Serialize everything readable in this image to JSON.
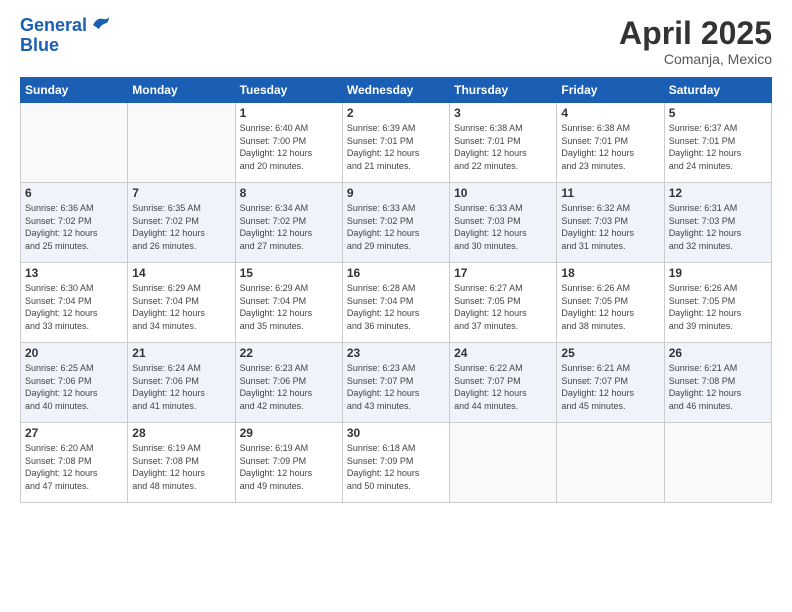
{
  "logo": {
    "line1": "General",
    "line2": "Blue"
  },
  "title": "April 2025",
  "location": "Comanja, Mexico",
  "weekdays": [
    "Sunday",
    "Monday",
    "Tuesday",
    "Wednesday",
    "Thursday",
    "Friday",
    "Saturday"
  ],
  "rows": [
    [
      {
        "day": "",
        "info": ""
      },
      {
        "day": "",
        "info": ""
      },
      {
        "day": "1",
        "info": "Sunrise: 6:40 AM\nSunset: 7:00 PM\nDaylight: 12 hours\nand 20 minutes."
      },
      {
        "day": "2",
        "info": "Sunrise: 6:39 AM\nSunset: 7:01 PM\nDaylight: 12 hours\nand 21 minutes."
      },
      {
        "day": "3",
        "info": "Sunrise: 6:38 AM\nSunset: 7:01 PM\nDaylight: 12 hours\nand 22 minutes."
      },
      {
        "day": "4",
        "info": "Sunrise: 6:38 AM\nSunset: 7:01 PM\nDaylight: 12 hours\nand 23 minutes."
      },
      {
        "day": "5",
        "info": "Sunrise: 6:37 AM\nSunset: 7:01 PM\nDaylight: 12 hours\nand 24 minutes."
      }
    ],
    [
      {
        "day": "6",
        "info": "Sunrise: 6:36 AM\nSunset: 7:02 PM\nDaylight: 12 hours\nand 25 minutes."
      },
      {
        "day": "7",
        "info": "Sunrise: 6:35 AM\nSunset: 7:02 PM\nDaylight: 12 hours\nand 26 minutes."
      },
      {
        "day": "8",
        "info": "Sunrise: 6:34 AM\nSunset: 7:02 PM\nDaylight: 12 hours\nand 27 minutes."
      },
      {
        "day": "9",
        "info": "Sunrise: 6:33 AM\nSunset: 7:02 PM\nDaylight: 12 hours\nand 29 minutes."
      },
      {
        "day": "10",
        "info": "Sunrise: 6:33 AM\nSunset: 7:03 PM\nDaylight: 12 hours\nand 30 minutes."
      },
      {
        "day": "11",
        "info": "Sunrise: 6:32 AM\nSunset: 7:03 PM\nDaylight: 12 hours\nand 31 minutes."
      },
      {
        "day": "12",
        "info": "Sunrise: 6:31 AM\nSunset: 7:03 PM\nDaylight: 12 hours\nand 32 minutes."
      }
    ],
    [
      {
        "day": "13",
        "info": "Sunrise: 6:30 AM\nSunset: 7:04 PM\nDaylight: 12 hours\nand 33 minutes."
      },
      {
        "day": "14",
        "info": "Sunrise: 6:29 AM\nSunset: 7:04 PM\nDaylight: 12 hours\nand 34 minutes."
      },
      {
        "day": "15",
        "info": "Sunrise: 6:29 AM\nSunset: 7:04 PM\nDaylight: 12 hours\nand 35 minutes."
      },
      {
        "day": "16",
        "info": "Sunrise: 6:28 AM\nSunset: 7:04 PM\nDaylight: 12 hours\nand 36 minutes."
      },
      {
        "day": "17",
        "info": "Sunrise: 6:27 AM\nSunset: 7:05 PM\nDaylight: 12 hours\nand 37 minutes."
      },
      {
        "day": "18",
        "info": "Sunrise: 6:26 AM\nSunset: 7:05 PM\nDaylight: 12 hours\nand 38 minutes."
      },
      {
        "day": "19",
        "info": "Sunrise: 6:26 AM\nSunset: 7:05 PM\nDaylight: 12 hours\nand 39 minutes."
      }
    ],
    [
      {
        "day": "20",
        "info": "Sunrise: 6:25 AM\nSunset: 7:06 PM\nDaylight: 12 hours\nand 40 minutes."
      },
      {
        "day": "21",
        "info": "Sunrise: 6:24 AM\nSunset: 7:06 PM\nDaylight: 12 hours\nand 41 minutes."
      },
      {
        "day": "22",
        "info": "Sunrise: 6:23 AM\nSunset: 7:06 PM\nDaylight: 12 hours\nand 42 minutes."
      },
      {
        "day": "23",
        "info": "Sunrise: 6:23 AM\nSunset: 7:07 PM\nDaylight: 12 hours\nand 43 minutes."
      },
      {
        "day": "24",
        "info": "Sunrise: 6:22 AM\nSunset: 7:07 PM\nDaylight: 12 hours\nand 44 minutes."
      },
      {
        "day": "25",
        "info": "Sunrise: 6:21 AM\nSunset: 7:07 PM\nDaylight: 12 hours\nand 45 minutes."
      },
      {
        "day": "26",
        "info": "Sunrise: 6:21 AM\nSunset: 7:08 PM\nDaylight: 12 hours\nand 46 minutes."
      }
    ],
    [
      {
        "day": "27",
        "info": "Sunrise: 6:20 AM\nSunset: 7:08 PM\nDaylight: 12 hours\nand 47 minutes."
      },
      {
        "day": "28",
        "info": "Sunrise: 6:19 AM\nSunset: 7:08 PM\nDaylight: 12 hours\nand 48 minutes."
      },
      {
        "day": "29",
        "info": "Sunrise: 6:19 AM\nSunset: 7:09 PM\nDaylight: 12 hours\nand 49 minutes."
      },
      {
        "day": "30",
        "info": "Sunrise: 6:18 AM\nSunset: 7:09 PM\nDaylight: 12 hours\nand 50 minutes."
      },
      {
        "day": "",
        "info": ""
      },
      {
        "day": "",
        "info": ""
      },
      {
        "day": "",
        "info": ""
      }
    ]
  ]
}
